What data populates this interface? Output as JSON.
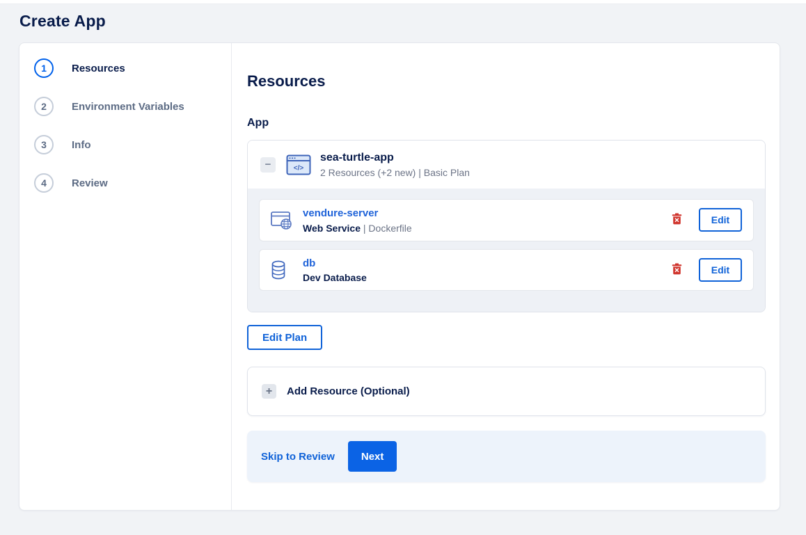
{
  "page": {
    "title": "Create App"
  },
  "colors": {
    "accent": "#0061eb",
    "danger": "#d0342c",
    "navy": "#081b4a"
  },
  "stepper": {
    "steps": [
      {
        "number": "1",
        "label": "Resources",
        "active": true
      },
      {
        "number": "2",
        "label": "Environment Variables",
        "active": false
      },
      {
        "number": "3",
        "label": "Info",
        "active": false
      },
      {
        "number": "4",
        "label": "Review",
        "active": false
      }
    ]
  },
  "main": {
    "heading": "Resources",
    "section_label": "App",
    "app": {
      "collapse_glyph": "−",
      "icon": "app-window-code-icon",
      "name": "sea-turtle-app",
      "summary": "2 Resources (+2 new) | Basic Plan",
      "resources": [
        {
          "icon": "web-service-icon",
          "name": "vendure-server",
          "type": "Web Service",
          "detail": " | Dockerfile",
          "delete_icon": "trash-icon",
          "edit_label": "Edit"
        },
        {
          "icon": "database-icon",
          "name": "db",
          "type": "Dev Database",
          "detail": "",
          "delete_icon": "trash-icon",
          "edit_label": "Edit"
        }
      ]
    },
    "edit_plan_label": "Edit Plan",
    "add_resource": {
      "plus_glyph": "+",
      "label": "Add Resource (Optional)"
    },
    "footer": {
      "skip_label": "Skip to Review",
      "next_label": "Next"
    }
  }
}
